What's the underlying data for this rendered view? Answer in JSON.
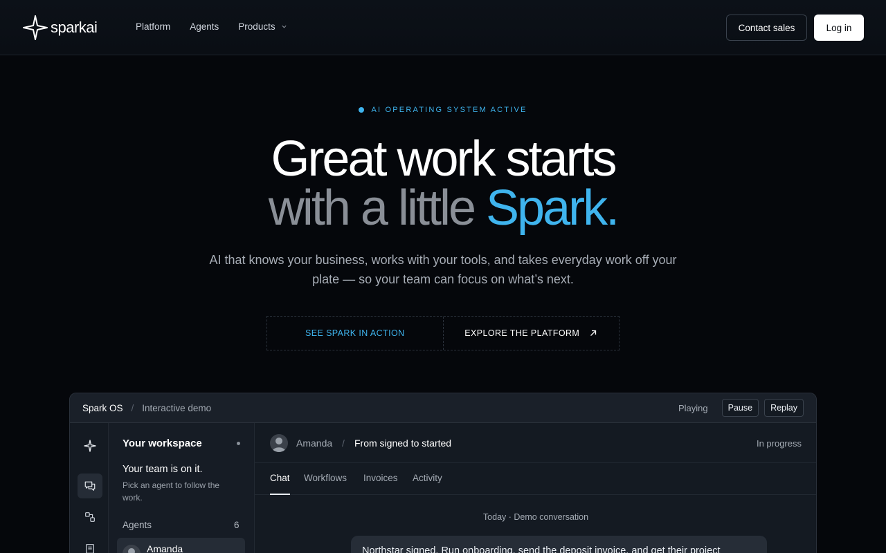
{
  "brand": {
    "name": "sparkai"
  },
  "nav": {
    "links": [
      "Platform",
      "Agents",
      "Products"
    ],
    "contact_label": "Contact sales",
    "login_label": "Log in"
  },
  "hero": {
    "status": "AI OPERATING SYSTEM ACTIVE",
    "headline_line1": "Great work starts",
    "headline_line2_prefix": "with a little ",
    "headline_line2_accent": "Spark.",
    "subtitle": "AI that knows your business, works with your tools, and takes everyday work off your plate — so your team can focus on what’s next.",
    "cta_primary": "SEE SPARK IN ACTION",
    "cta_secondary": "EXPLORE THE PLATFORM"
  },
  "demo": {
    "crumb_app": "Spark OS",
    "crumb_sep": "/",
    "crumb_page": "Interactive demo",
    "playing": "Playing",
    "pause_label": "Pause",
    "replay_label": "Replay",
    "workspace_title": "Your workspace",
    "team_line": "Your team is on it.",
    "pick_line": "Pick an agent to follow the work.",
    "agents_label": "Agents",
    "agents_count": "6",
    "agent_name": "Amanda",
    "main_agent": "Amanda",
    "main_sep": "/",
    "main_title": "From signed to started",
    "main_status": "In progress",
    "tabs": [
      "Chat",
      "Workflows",
      "Invoices",
      "Activity"
    ],
    "day_label": "Today · Demo conversation",
    "message": "Northstar signed. Run onboarding, send the deposit invoice, and get their project"
  },
  "colors": {
    "accent": "#3fb4ee",
    "background": "#05070b"
  }
}
